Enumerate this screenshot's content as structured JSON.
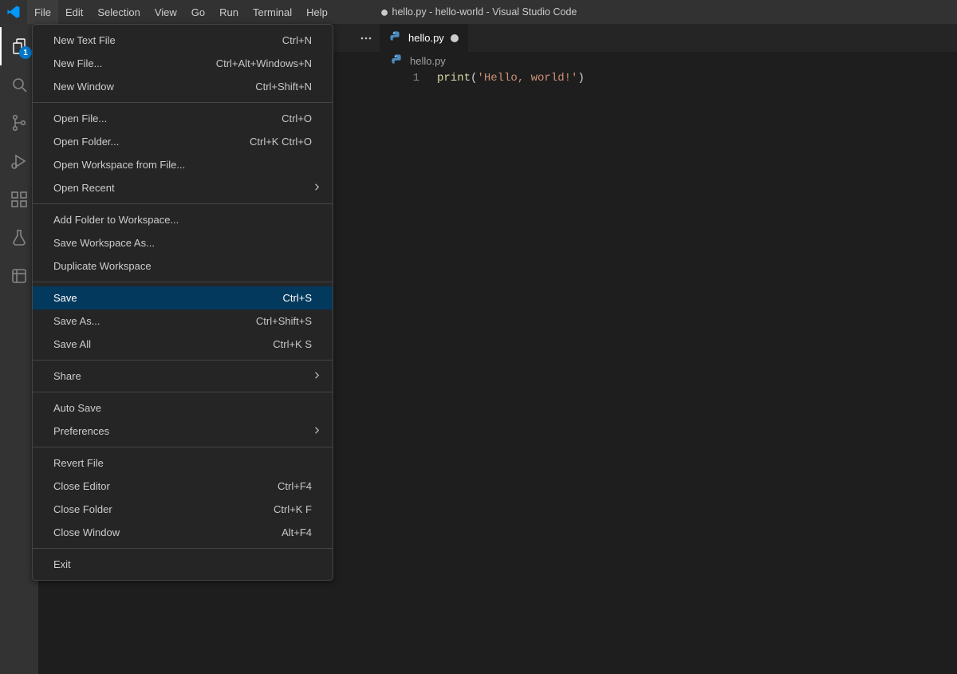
{
  "title": {
    "dirty_dot": "●",
    "text": "hello.py - hello-world - Visual Studio Code"
  },
  "menubar": [
    "File",
    "Edit",
    "Selection",
    "View",
    "Go",
    "Run",
    "Terminal",
    "Help"
  ],
  "active_menu_index": 0,
  "activitybar": {
    "explorer_badge": "1"
  },
  "tab": {
    "filename": "hello.py"
  },
  "breadcrumbs": {
    "filename": "hello.py"
  },
  "editor": {
    "line_number": "1",
    "code_fn": "print",
    "code_open": "(",
    "code_str": "'Hello, world!'",
    "code_close": ")"
  },
  "file_menu": [
    {
      "type": "item",
      "label": "New Text File",
      "shortcut": "Ctrl+N"
    },
    {
      "type": "item",
      "label": "New File...",
      "shortcut": "Ctrl+Alt+Windows+N"
    },
    {
      "type": "item",
      "label": "New Window",
      "shortcut": "Ctrl+Shift+N"
    },
    {
      "type": "div"
    },
    {
      "type": "item",
      "label": "Open File...",
      "shortcut": "Ctrl+O"
    },
    {
      "type": "item",
      "label": "Open Folder...",
      "shortcut": "Ctrl+K Ctrl+O"
    },
    {
      "type": "item",
      "label": "Open Workspace from File...",
      "shortcut": ""
    },
    {
      "type": "sub",
      "label": "Open Recent"
    },
    {
      "type": "div"
    },
    {
      "type": "item",
      "label": "Add Folder to Workspace...",
      "shortcut": ""
    },
    {
      "type": "item",
      "label": "Save Workspace As...",
      "shortcut": ""
    },
    {
      "type": "item",
      "label": "Duplicate Workspace",
      "shortcut": ""
    },
    {
      "type": "div"
    },
    {
      "type": "item",
      "label": "Save",
      "shortcut": "Ctrl+S",
      "highlight": true
    },
    {
      "type": "item",
      "label": "Save As...",
      "shortcut": "Ctrl+Shift+S"
    },
    {
      "type": "item",
      "label": "Save All",
      "shortcut": "Ctrl+K S"
    },
    {
      "type": "div"
    },
    {
      "type": "sub",
      "label": "Share"
    },
    {
      "type": "div"
    },
    {
      "type": "item",
      "label": "Auto Save",
      "shortcut": ""
    },
    {
      "type": "sub",
      "label": "Preferences"
    },
    {
      "type": "div"
    },
    {
      "type": "item",
      "label": "Revert File",
      "shortcut": ""
    },
    {
      "type": "item",
      "label": "Close Editor",
      "shortcut": "Ctrl+F4"
    },
    {
      "type": "item",
      "label": "Close Folder",
      "shortcut": "Ctrl+K F"
    },
    {
      "type": "item",
      "label": "Close Window",
      "shortcut": "Alt+F4"
    },
    {
      "type": "div"
    },
    {
      "type": "item",
      "label": "Exit",
      "shortcut": ""
    }
  ]
}
